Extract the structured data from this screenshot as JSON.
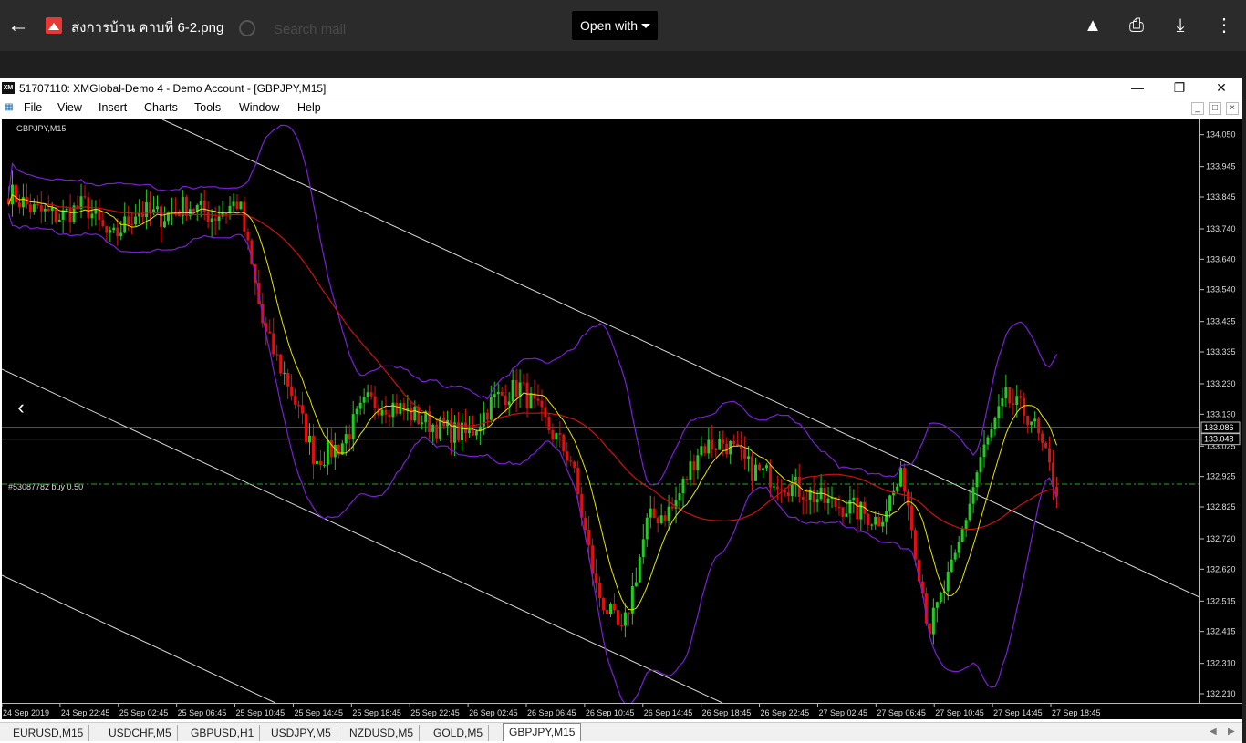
{
  "viewer": {
    "filename": "ส่งการบ้าน คาบที่ 6-2.png",
    "ghost_search": "Search mail",
    "open_with": "Open with",
    "icons": [
      "back-arrow-icon",
      "drive-add-icon",
      "print-icon",
      "download-icon",
      "more-vert-icon"
    ]
  },
  "window": {
    "title": "51707110: XMGlobal-Demo 4 - Demo Account - [GBPJPY,M15]",
    "logo": "XM",
    "min": "—",
    "max": "❐",
    "close": "✕"
  },
  "menu": {
    "items": [
      {
        "label": "File",
        "ul": "F"
      },
      {
        "label": "View",
        "ul": "V"
      },
      {
        "label": "Insert",
        "ul": "I"
      },
      {
        "label": "Charts",
        "ul": "C"
      },
      {
        "label": "Tools",
        "ul": "T"
      },
      {
        "label": "Window",
        "ul": "W"
      },
      {
        "label": "Help",
        "ul": "H"
      }
    ]
  },
  "chart": {
    "symbol_label": "GBPJPY,M15",
    "order_label": "#53087782 buy 0.50",
    "price_ticks": [
      "134.050",
      "133.945",
      "133.845",
      "133.740",
      "133.640",
      "133.540",
      "133.435",
      "133.335",
      "133.230",
      "133.130",
      "133.025",
      "132.925",
      "132.825",
      "132.720",
      "132.620",
      "132.515",
      "132.415",
      "132.310",
      "132.210"
    ],
    "price_tag_1": "133.086",
    "price_tag_2": "133.048",
    "time_ticks": [
      "24 Sep 2019",
      "24 Sep 22:45",
      "25 Sep 02:45",
      "25 Sep 06:45",
      "25 Sep 10:45",
      "25 Sep 14:45",
      "25 Sep 18:45",
      "25 Sep 22:45",
      "26 Sep 02:45",
      "26 Sep 06:45",
      "26 Sep 10:45",
      "26 Sep 14:45",
      "26 Sep 18:45",
      "26 Sep 22:45",
      "27 Sep 02:45",
      "27 Sep 06:45",
      "27 Sep 10:45",
      "27 Sep 14:45",
      "27 Sep 18:45"
    ],
    "colors": {
      "bull": "#22cc22",
      "bear": "#dd1111",
      "ma_fast": "#e6e600",
      "ma_slow": "#cc1111",
      "bands": "#7a1fd6",
      "channel": "#d8d8d8",
      "order": "#1faa1f"
    }
  },
  "chart_data": {
    "type": "candlestick",
    "symbol": "GBPJPY",
    "timeframe": "M15",
    "ylim": [
      132.18,
      134.1
    ],
    "x": [
      "24 Sep 2019",
      "24 Sep 22:45",
      "25 Sep 02:45",
      "25 Sep 06:45",
      "25 Sep 10:45",
      "25 Sep 14:45",
      "25 Sep 18:45",
      "25 Sep 22:45",
      "26 Sep 02:45",
      "26 Sep 06:45",
      "26 Sep 10:45",
      "26 Sep 14:45",
      "26 Sep 18:45",
      "26 Sep 22:45",
      "27 Sep 02:45",
      "27 Sep 06:45",
      "27 Sep 10:45",
      "27 Sep 14:45",
      "27 Sep 18:45"
    ],
    "close_path": [
      133.86,
      133.8,
      133.78,
      133.82,
      133.7,
      133.8,
      133.78,
      133.82,
      133.78,
      133.83,
      133.4,
      133.22,
      132.98,
      133.03,
      133.17,
      133.16,
      133.12,
      133.08,
      133.06,
      133.18,
      133.22,
      133.1,
      132.98,
      132.55,
      132.4,
      132.78,
      132.82,
      133.02,
      133.04,
      132.95,
      132.92,
      132.88,
      132.84,
      132.82,
      132.78,
      132.93,
      132.42,
      132.64,
      132.98,
      133.18,
      133.12,
      132.88
    ],
    "order_price": 132.9,
    "price_lines": [
      133.086,
      133.048
    ]
  },
  "tabs": [
    "EURUSD,M15",
    "USDCHF,M5",
    "GBPUSD,H1",
    "USDJPY,M5",
    "NZDUSD,M5",
    "GOLD,M5",
    "GBPJPY,M15"
  ],
  "active_tab": "GBPJPY,M15"
}
